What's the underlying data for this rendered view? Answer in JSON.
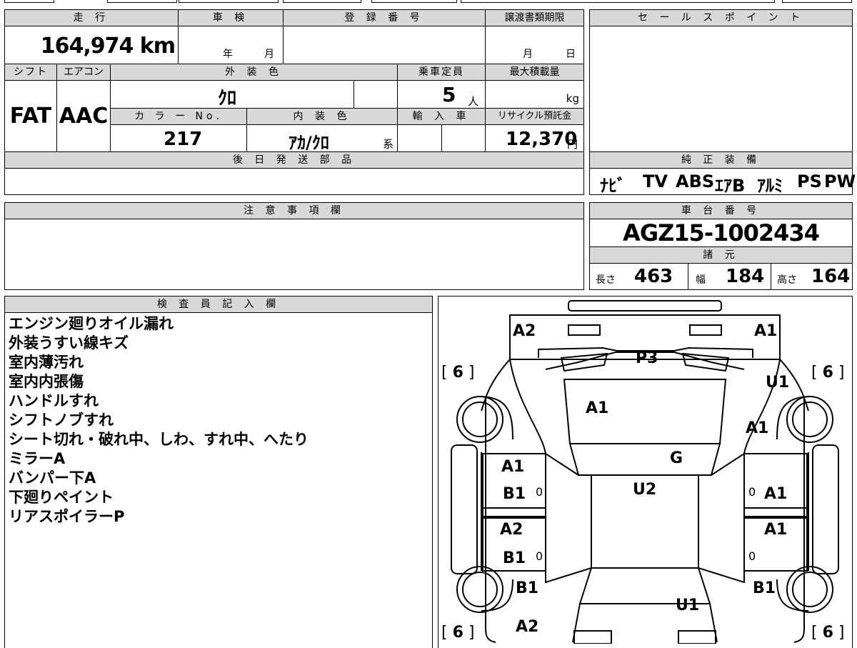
{
  "mileage": {
    "header": "走 行",
    "value": "164,974 km"
  },
  "inspection": {
    "header": "車 検",
    "year_label": "年",
    "month_label": "月"
  },
  "registration": {
    "header": "登 録 番 号"
  },
  "transfer_deadline": {
    "header": "譲渡書類期限",
    "month_label": "月",
    "day_label": "日"
  },
  "shift": {
    "header": "シフト",
    "value": "FAT"
  },
  "aircon": {
    "header": "エアコン",
    "value": "AAC"
  },
  "exterior_color": {
    "header": "外 装 色",
    "value": "ｸﾛ"
  },
  "capacity": {
    "header": "乗車定員",
    "value": "5",
    "unit": "人"
  },
  "max_load": {
    "header": "最大積載量",
    "unit": "kg"
  },
  "color_no": {
    "header": "カ ラ ー No.",
    "value": "217"
  },
  "interior_color": {
    "header": "内 装 色",
    "value": "ｱｶ/ｸﾛ",
    "suffix": "系"
  },
  "import": {
    "header": "輸 入 車"
  },
  "recycle": {
    "header": "リサイクル預託金",
    "value": "12,370",
    "unit": "円"
  },
  "later_parts": {
    "header": "後 日 発 送 部 品"
  },
  "sales_point": {
    "header": "セ ー ル ス ポ イ ン ト"
  },
  "genuine_equipment": {
    "header": "純 正 装 備",
    "items": [
      "ﾅﾋﾞ",
      "TV",
      "ABS",
      "ｴｱB",
      "ｱﾙﾐ",
      "PS",
      "PW"
    ]
  },
  "notes": {
    "header": "注 意 事 項 欄"
  },
  "chassis": {
    "header": "車 台 番 号",
    "value": "AGZ15-1002434"
  },
  "specs": {
    "header": "諸 元",
    "length_label": "長さ",
    "length": "463",
    "width_label": "幅",
    "width": "184",
    "height_label": "高さ",
    "height": "164"
  },
  "inspector": {
    "header": "検 査 員 記 入 欄",
    "lines": [
      "エンジン廻りオイル漏れ",
      "外装うすい線キズ",
      "室内薄汚れ",
      "室内内張傷",
      "ハンドルすれ",
      "シフトノブすれ",
      "シート切れ・破れ中、しわ、すれ中、へたり",
      "ミラーA",
      "バンパー下A",
      "下廻りペイント",
      "リアスポイラーP"
    ]
  },
  "diagram": {
    "tire_label": "6",
    "marks": {
      "front_left": "A2",
      "front_right": "A1",
      "windshield": "P3",
      "right_front_fender": "U1",
      "hood": "A1",
      "right_front_door_area": "A1",
      "roof_glass": "G",
      "left_front_door_1": "A1",
      "left_front_door_2": "B1",
      "roof": "U2",
      "right_front_door": "A1",
      "left_rear_door_1": "A2",
      "left_rear_door_2": "B1",
      "right_rear_door": "A1",
      "left_rear_quarter": "B1",
      "right_rear_quarter": "B1",
      "trunk": "U1",
      "rear_left": "A2"
    },
    "small_marks": [
      "0",
      "0",
      "0",
      "0"
    ]
  }
}
